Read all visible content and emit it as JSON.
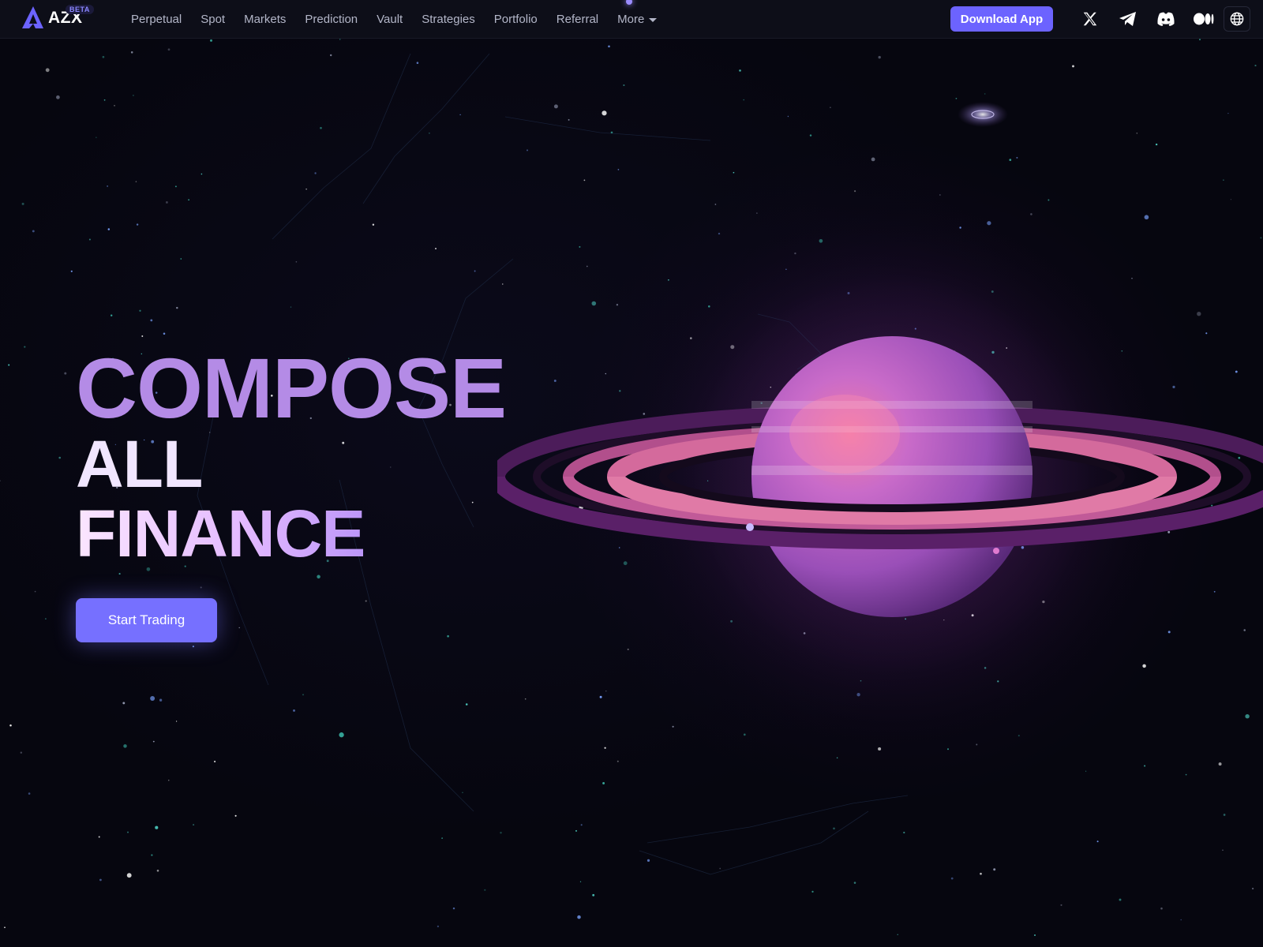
{
  "nav": {
    "logo_text": "AZX",
    "beta_label": "BETA",
    "items": [
      {
        "label": "Perpetual"
      },
      {
        "label": "Spot"
      },
      {
        "label": "Markets"
      },
      {
        "label": "Prediction"
      },
      {
        "label": "Vault"
      },
      {
        "label": "Strategies"
      },
      {
        "label": "Portfolio"
      },
      {
        "label": "Referral"
      }
    ],
    "more_label": "More",
    "download_label": "Download App",
    "social_icons": [
      "x-icon",
      "telegram-icon",
      "discord-icon",
      "medium-icon"
    ],
    "language_icon": "globe-icon"
  },
  "hero": {
    "line1": "COMPOSE",
    "line2": "ALL",
    "line3": "FINANCE",
    "cta_label": "Start Trading"
  },
  "colors": {
    "accent": "#6c63ff",
    "cta": "#7670ff",
    "background": "#06060f",
    "nav_background": "#0d0e18",
    "planet": "#b25fd0"
  }
}
